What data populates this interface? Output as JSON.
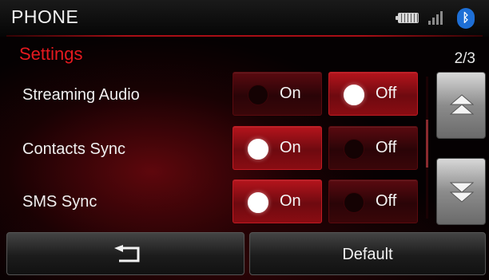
{
  "header": {
    "title": "PHONE",
    "status_icons": [
      "battery-icon",
      "signal-icon",
      "bluetooth-icon"
    ],
    "bluetooth_glyph": "ᛒ"
  },
  "settings": {
    "title": "Settings",
    "page": "2/3",
    "rows": [
      {
        "label": "Streaming Audio",
        "on_label": "On",
        "off_label": "Off",
        "selected": "Off"
      },
      {
        "label": "Contacts Sync",
        "on_label": "On",
        "off_label": "Off",
        "selected": "On"
      },
      {
        "label": "SMS Sync",
        "on_label": "On",
        "off_label": "Off",
        "selected": "On"
      }
    ]
  },
  "scroll": {
    "up_icon": "double-chevron-up-icon",
    "down_icon": "double-chevron-down-icon"
  },
  "bottom": {
    "back_icon": "back-arrow-icon",
    "default_label": "Default"
  },
  "colors": {
    "accent_red": "#e5191f",
    "selected_button": "#b5141c",
    "bluetooth_blue": "#1e6fd6"
  }
}
